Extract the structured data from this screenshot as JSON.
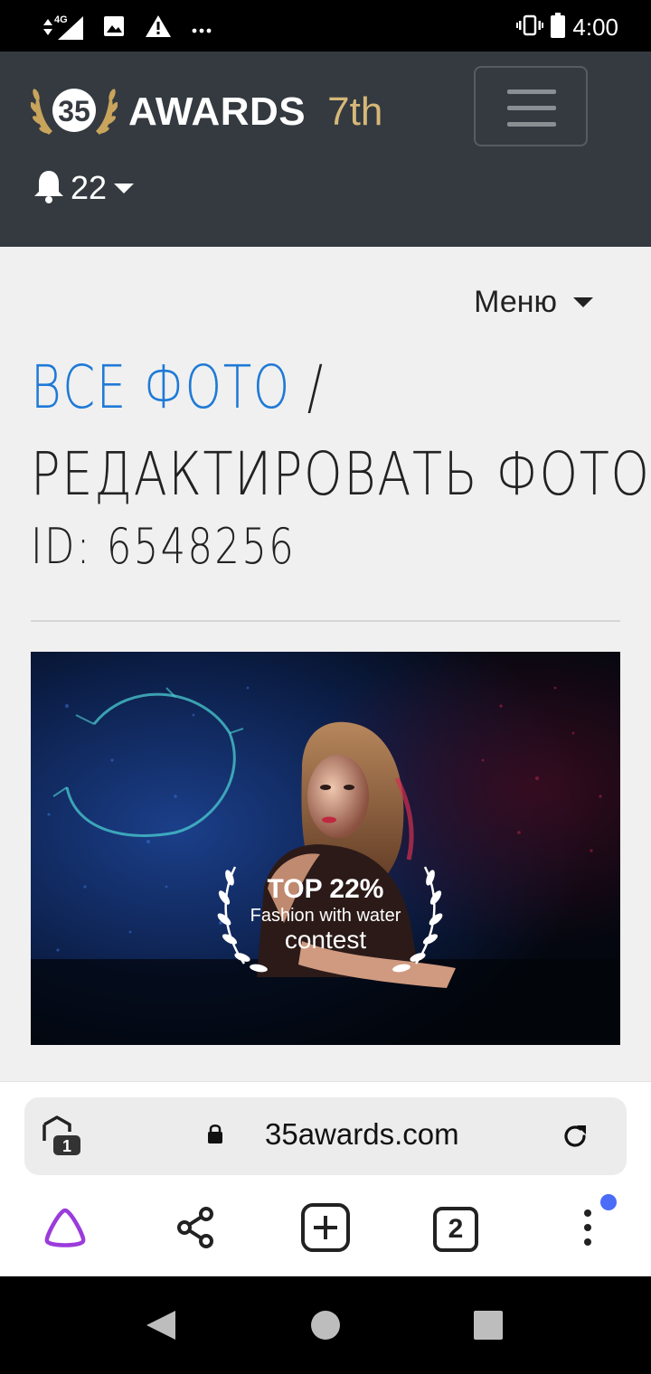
{
  "status_bar": {
    "network": "4G",
    "time": "4:00",
    "icons": [
      "signal-icon",
      "image-icon",
      "warning-icon",
      "more-icon",
      "vibrate-icon",
      "battery-icon"
    ]
  },
  "navbar": {
    "logo_monogram": "35",
    "brand": "AWARDS",
    "edition": "7th",
    "notifications_count": "22"
  },
  "main": {
    "menu_label": "Меню",
    "breadcrumb_link": "ВСЕ ФОТО",
    "breadcrumb_separator": " /",
    "page_title": "РЕДАКТИРОВАТЬ ФОТО",
    "photo_id": "ID: 6548256",
    "photo_badge": {
      "rank": "TOP 22%",
      "contest_name": "Fashion with water",
      "contest_word": "contest"
    }
  },
  "browser": {
    "url": "35awards.com",
    "tab_count": "2",
    "security_badge_count": "1"
  },
  "colors": {
    "navbar_bg": "#343a40",
    "link": "#1f7ad6",
    "edition_gold": "#d6b878",
    "assistant_purple": "#9b3bdc",
    "notify_dot": "#4a6cf7"
  }
}
